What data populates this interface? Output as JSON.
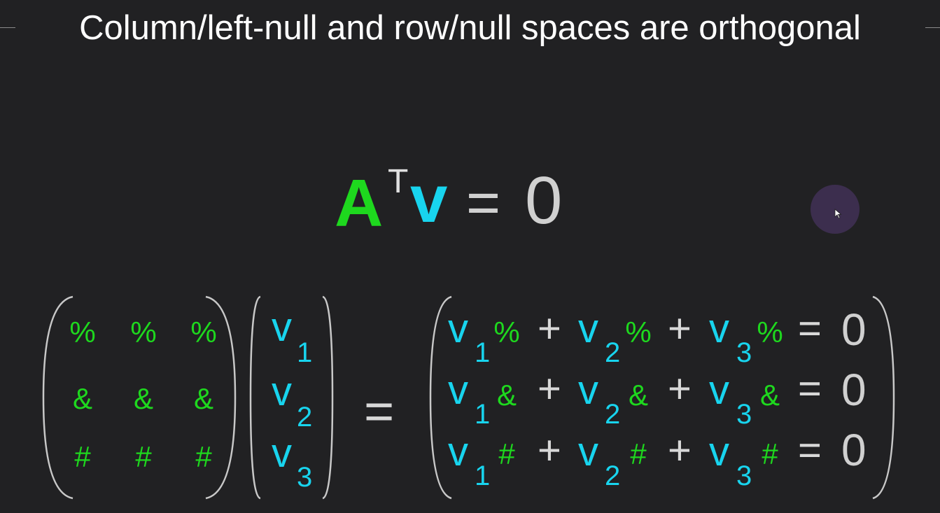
{
  "title": "Column/left-null and row/null spaces are orthogonal",
  "colors": {
    "background": "#212123",
    "green": "#1ed81e",
    "cyan": "#18d4ee",
    "grey": "#d0d0d0",
    "cursor_halo": "#3c2e4e"
  },
  "main_equation": {
    "matrix": "A",
    "superscript": "T",
    "vector": "v",
    "equals": "=",
    "rhs": "0"
  },
  "matrix_rows": [
    [
      "%",
      "%",
      "%"
    ],
    [
      "&",
      "&",
      "&"
    ],
    [
      "#",
      "#",
      "#"
    ]
  ],
  "vector_entries": [
    {
      "letter": "v",
      "sub": "1"
    },
    {
      "letter": "v",
      "sub": "2"
    },
    {
      "letter": "v",
      "sub": "3"
    }
  ],
  "middle_equals": "=",
  "result_rows": [
    {
      "terms": [
        {
          "letter": "v",
          "sub": "1",
          "sym": "%"
        },
        {
          "letter": "v",
          "sub": "2",
          "sym": "%"
        },
        {
          "letter": "v",
          "sub": "3",
          "sym": "%"
        }
      ],
      "plus": "+",
      "equals": "=",
      "rhs": "0"
    },
    {
      "terms": [
        {
          "letter": "v",
          "sub": "1",
          "sym": "&"
        },
        {
          "letter": "v",
          "sub": "2",
          "sym": "&"
        },
        {
          "letter": "v",
          "sub": "3",
          "sym": "&"
        }
      ],
      "plus": "+",
      "equals": "=",
      "rhs": "0"
    },
    {
      "terms": [
        {
          "letter": "v",
          "sub": "1",
          "sym": "#"
        },
        {
          "letter": "v",
          "sub": "2",
          "sym": "#"
        },
        {
          "letter": "v",
          "sub": "3",
          "sym": "#"
        }
      ],
      "plus": "+",
      "equals": "=",
      "rhs": "0"
    }
  ],
  "cursor_icon": "mouse-pointer-icon"
}
